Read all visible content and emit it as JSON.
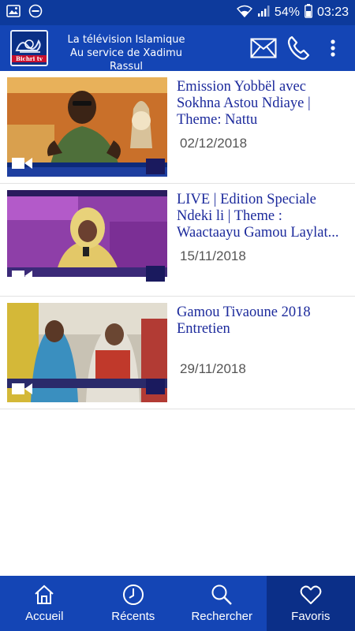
{
  "status_bar": {
    "battery": "54%",
    "time": "03:23",
    "icons": [
      "image-icon",
      "minus-circle-icon",
      "wifi-icon",
      "signal-icon",
      "battery-icon"
    ]
  },
  "header": {
    "logo_text": "Bichri tv",
    "tagline_line1": "La télévision Islamique",
    "tagline_line2": "Au service de Xadimu Rassul",
    "icons": [
      "mail-icon",
      "phone-icon",
      "more-vertical-icon"
    ]
  },
  "videos": [
    {
      "title": "Emission Yobbël avec Sokhna Astou Ndiaye | Theme: Nattu",
      "date": "02/12/2018"
    },
    {
      "title": "LIVE | Edition Speciale Ndeki li | Theme : Waactaayu Gamou Laylat...",
      "date": "15/11/2018"
    },
    {
      "title": "Gamou Tivaoune 2018 Entretien",
      "date": "29/11/2018"
    }
  ],
  "bottom_nav": {
    "items": [
      {
        "label": "Accueil",
        "icon": "home-icon"
      },
      {
        "label": "Récents",
        "icon": "clock-icon"
      },
      {
        "label": "Rechercher",
        "icon": "search-icon"
      },
      {
        "label": "Favoris",
        "icon": "heart-icon"
      }
    ],
    "active": "Favoris"
  },
  "colors": {
    "status_bar": "#0d3a9c",
    "header": "#1445b5",
    "nav_active": "#0b2f88",
    "title_text": "#1c2a9c",
    "date_text": "#555555"
  }
}
